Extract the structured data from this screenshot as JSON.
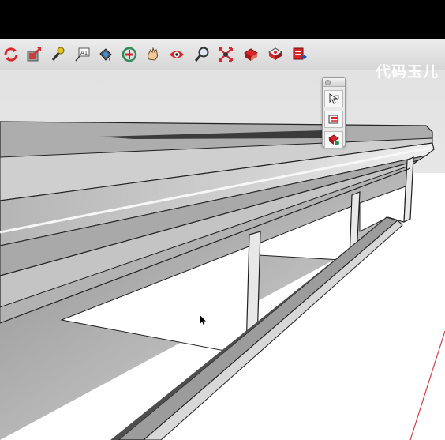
{
  "watermark": {
    "text": "代码玉儿"
  },
  "toolbar": {
    "tools": [
      {
        "name": "orbit-icon"
      },
      {
        "name": "push-pull-icon"
      },
      {
        "name": "tape-measure-icon"
      },
      {
        "name": "text-label-icon",
        "glyph": "A1"
      },
      {
        "name": "paint-bucket-icon"
      },
      {
        "name": "rotate-icon"
      },
      {
        "name": "pan-hand-icon"
      },
      {
        "name": "look-around-eye-icon"
      },
      {
        "name": "zoom-icon"
      },
      {
        "name": "zoom-extents-icon"
      },
      {
        "name": "components-icon"
      },
      {
        "name": "materials-icon"
      },
      {
        "name": "export-icon"
      }
    ]
  },
  "palette": {
    "buttons": [
      {
        "name": "select-tool-icon"
      },
      {
        "name": "section-plane-icon"
      },
      {
        "name": "component-options-icon"
      }
    ]
  },
  "colors": {
    "accent_red": "#d9262a",
    "topbar": "#000000",
    "toolbar_bg": "#e2e2e2",
    "model_gray": "#b9b9b9",
    "axis_red": "#d04040"
  }
}
